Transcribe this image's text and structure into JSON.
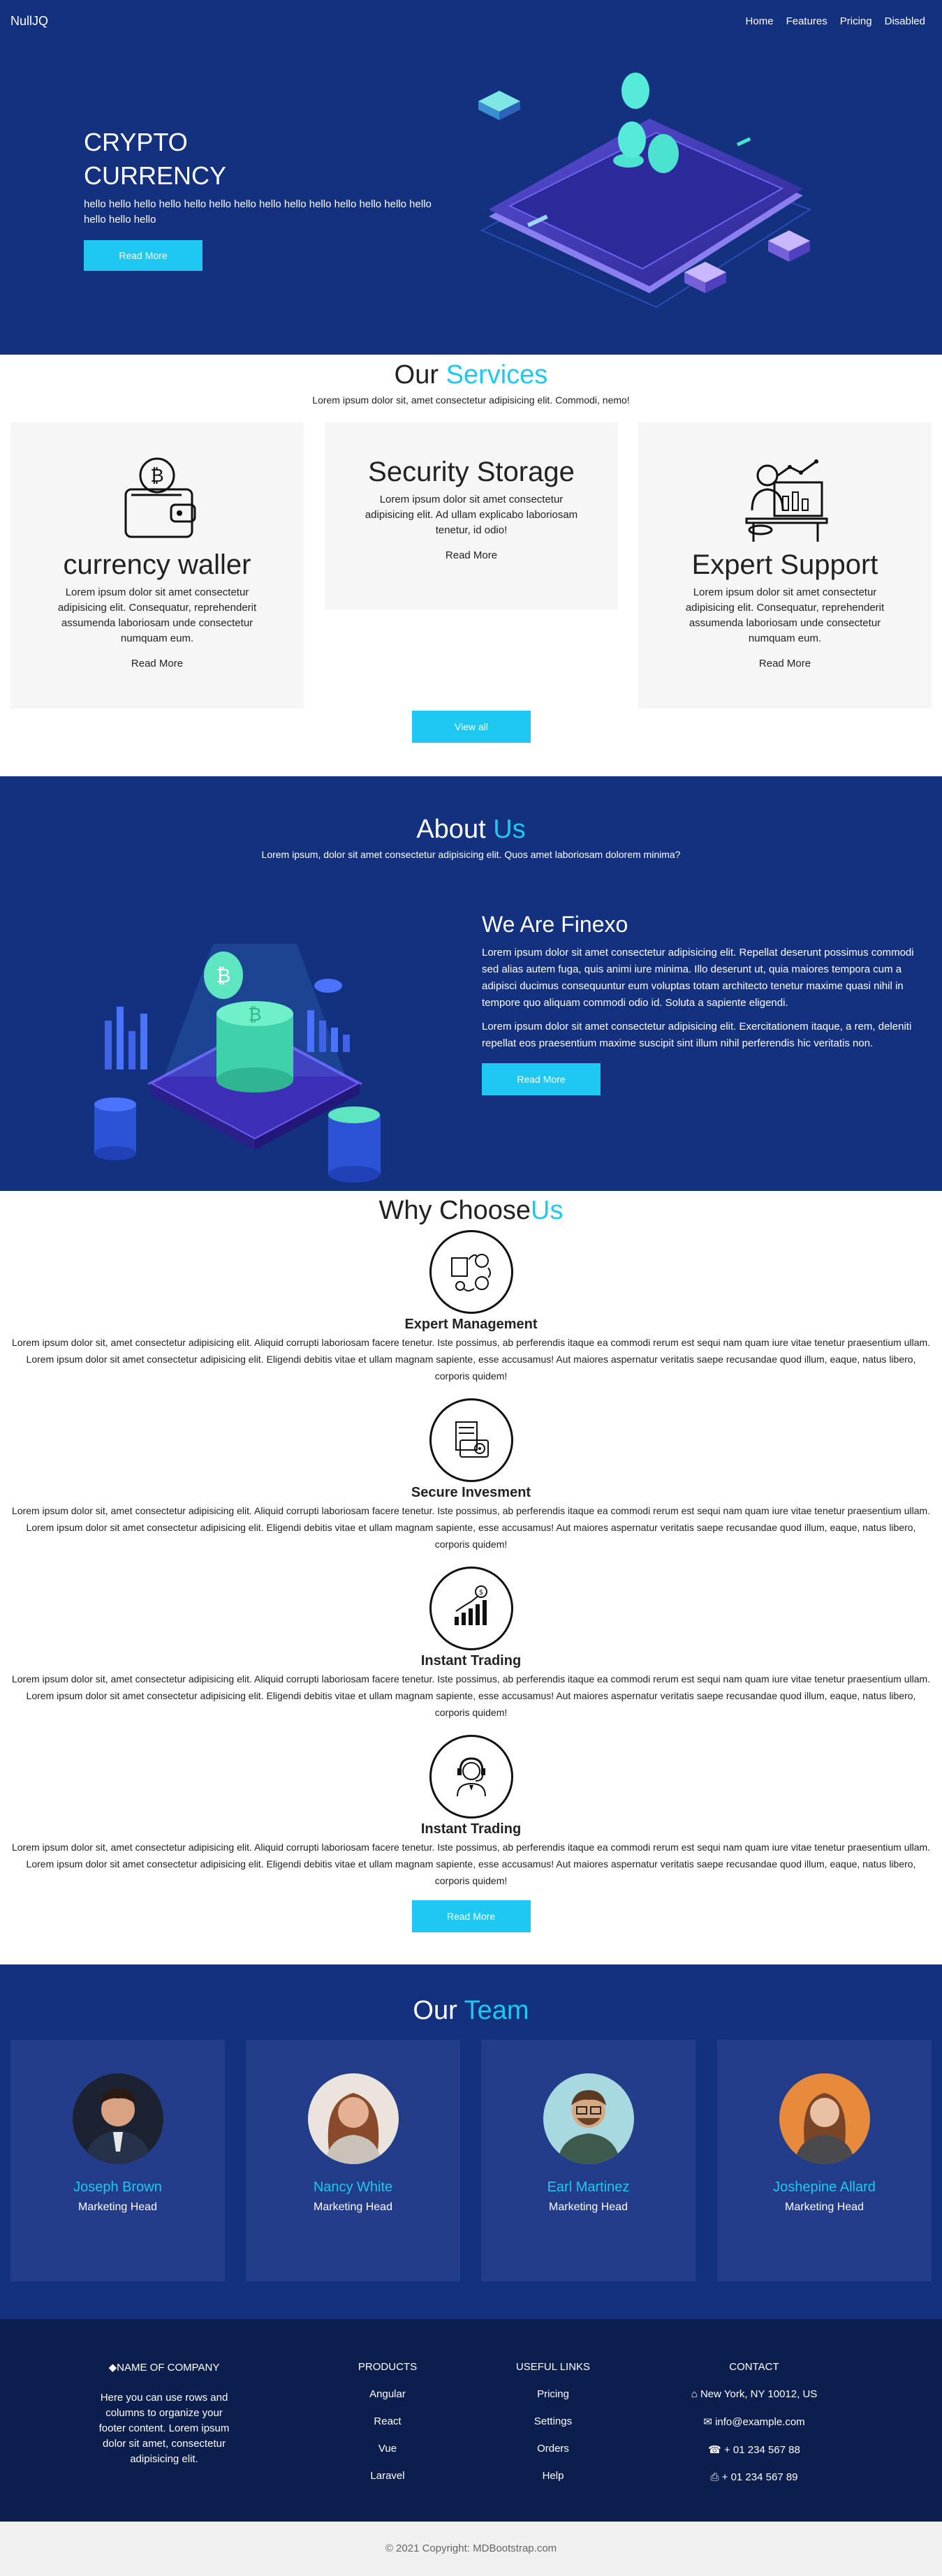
{
  "nav": {
    "brand": "NullJQ",
    "links": [
      "Home",
      "Features",
      "Pricing",
      "Disabled"
    ]
  },
  "hero": {
    "title_line1": "CRYPTO",
    "title_line2": "CURRENCY",
    "text": "hello hello hello hello hello hello hello hello hello hello hello hello hello hello hello hello hello",
    "button": "Read More"
  },
  "services": {
    "title_main": "Our",
    "title_accent": "Services",
    "subtitle": "Lorem ipsum dolor sit, amet consectetur adipisicing elit. Commodi, nemo!",
    "cards": [
      {
        "title": "currency waller",
        "text": "Lorem ipsum dolor sit amet consectetur adipisicing elit. Consequatur, reprehenderit assumenda laboriosam unde consectetur numquam eum.",
        "link": "Read More",
        "icon": "wallet-bitcoin-icon"
      },
      {
        "title": "Security Storage",
        "text": "Lorem ipsum dolor sit amet consectetur adipisicing elit. Ad ullam explicabo laboriosam tenetur, id odio!",
        "link": "Read More"
      },
      {
        "title": "Expert Support",
        "text": "Lorem ipsum dolor sit amet consectetur adipisicing elit. Consequatur, reprehenderit assumenda laboriosam unde consectetur numquam eum.",
        "link": "Read More",
        "icon": "support-desk-icon"
      }
    ],
    "view_all": "View all"
  },
  "about": {
    "title_main": "About",
    "title_accent": "Us",
    "subtitle": "Lorem ipsum, dolor sit amet consectetur adipisicing elit. Quos amet laboriosam dolorem minima?",
    "heading": "We Are Finexo",
    "para1": "Lorem ipsum dolor sit amet consectetur adipisicing elit. Repellat deserunt possimus commodi sed alias autem fuga, quis animi iure minima. Illo deserunt ut, quia maiores tempora cum a adipisci ducimus consequuntur eum voluptas totam architecto tenetur maxime quasi nihil in tempore quo aliquam commodi odio id. Soluta a sapiente eligendi.",
    "para2": "Lorem ipsum dolor sit amet consectetur adipisicing elit. Exercitationem itaque, a rem, deleniti repellat eos praesentium maxime suscipit sint illum nihil perferendis hic veritatis non.",
    "button": "Read More"
  },
  "why": {
    "title_main": "Why Choose",
    "title_accent": "Us",
    "features": [
      {
        "title": "Expert Management",
        "icon": "management-cycle-icon"
      },
      {
        "title": "Secure Invesment",
        "icon": "secure-card-icon"
      },
      {
        "title": "Instant Trading",
        "icon": "trading-chart-icon"
      },
      {
        "title": "Instant Trading",
        "icon": "headset-support-icon"
      }
    ],
    "feature_text": "Lorem ipsum dolor sit, amet consectetur adipisicing elit. Aliquid corrupti laboriosam facere tenetur. Iste possimus, ab perferendis itaque ea commodi rerum est sequi nam quam iure vitae tenetur praesentium ullam. Lorem ipsum dolor sit amet consectetur adipisicing elit. Eligendi debitis vitae et ullam magnam sapiente, esse accusamus! Aut maiores aspernatur veritatis saepe recusandae quod illum, eaque, natus libero, corporis quidem!",
    "button": "Read More"
  },
  "team": {
    "title_main": "Our",
    "title_accent": "Team",
    "members": [
      {
        "name": "Joseph Brown",
        "role": "Marketing Head"
      },
      {
        "name": "Nancy White",
        "role": "Marketing Head"
      },
      {
        "name": "Earl Martinez",
        "role": "Marketing Head"
      },
      {
        "name": "Joshepine Allard",
        "role": "Marketing Head"
      }
    ]
  },
  "footer": {
    "company_heading": "NAME OF COMPANY",
    "company_text": "Here you can use rows and columns to organize your footer content. Lorem ipsum dolor sit amet, consectetur adipisicing elit.",
    "products_heading": "PRODUCTS",
    "products": [
      "Angular",
      "React",
      "Vue",
      "Laravel"
    ],
    "links_heading": "USEFUL LINKS",
    "links": [
      "Pricing",
      "Settings",
      "Orders",
      "Help"
    ],
    "contact_heading": "CONTACT",
    "contact": {
      "address": "New York, NY 10012, US",
      "email": "info@example.com",
      "phone": "+ 01 234 567 88",
      "fax": "+ 01 234 567 89"
    },
    "copyright": "© 2021 Copyright: MDBootstrap.com"
  },
  "colors": {
    "navy": "#14317f",
    "accent": "#1ec8f0",
    "card_navy": "#243d8a",
    "footer_navy": "#0b1e4d"
  }
}
